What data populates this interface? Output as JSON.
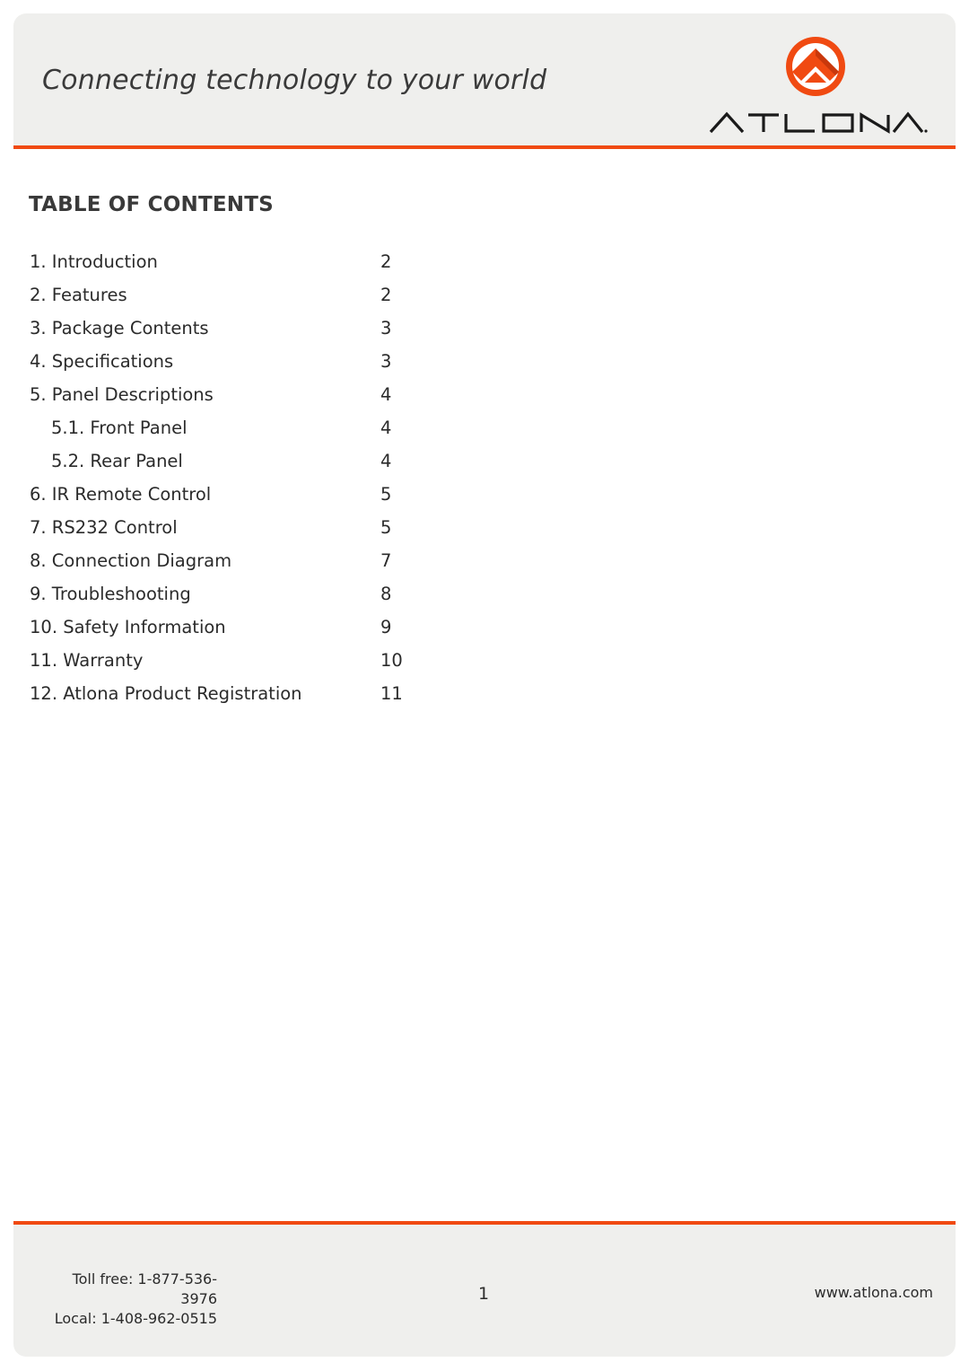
{
  "header": {
    "tagline": "Connecting technology to your world",
    "brand": "ATLONA",
    "brand_color": "#f04a12"
  },
  "toc": {
    "title": "TABLE OF CONTENTS",
    "entries": [
      {
        "label": "1. Introduction",
        "page": "2",
        "level": 1
      },
      {
        "label": "2. Features",
        "page": "2",
        "level": 1
      },
      {
        "label": "3. Package Contents",
        "page": "3",
        "level": 1
      },
      {
        "label": "4. Specifications",
        "page": "3",
        "level": 1
      },
      {
        "label": "5. Panel Descriptions",
        "page": "4",
        "level": 1
      },
      {
        "label": "5.1. Front Panel",
        "page": "4",
        "level": 2
      },
      {
        "label": "5.2. Rear Panel",
        "page": "4",
        "level": 2
      },
      {
        "label": "6. IR Remote Control",
        "page": "5",
        "level": 1
      },
      {
        "label": "7. RS232 Control",
        "page": "5",
        "level": 1
      },
      {
        "label": "8. Connection Diagram",
        "page": "7",
        "level": 1
      },
      {
        "label": "9. Troubleshooting",
        "page": "8",
        "level": 1
      },
      {
        "label": "10. Safety Information",
        "page": "9",
        "level": 1
      },
      {
        "label": "11. Warranty",
        "page": "10",
        "level": 1
      },
      {
        "label": "12. Atlona Product Registration",
        "page": "11",
        "level": 1
      }
    ]
  },
  "footer": {
    "toll_free": "Toll free: 1-877-536-3976",
    "local": "Local: 1-408-962-0515",
    "page_number": "1",
    "website": "www.atlona.com"
  }
}
